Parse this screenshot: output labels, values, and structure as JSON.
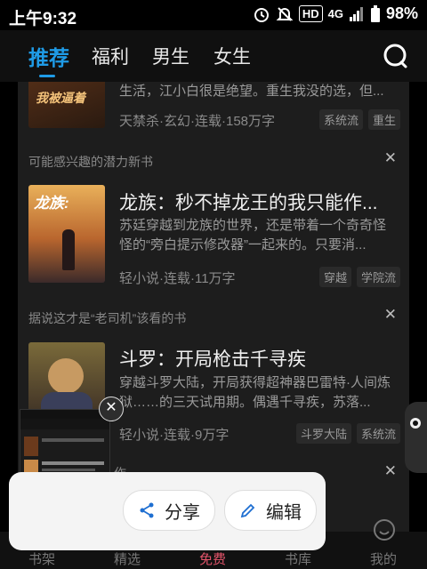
{
  "status": {
    "time": "上午9:32",
    "hd": "HD",
    "network": "4G",
    "battery": "98%"
  },
  "tabs": [
    "推荐",
    "福利",
    "男生",
    "女生"
  ],
  "books": [
    {
      "title": "",
      "desc_tail": "生活，江小白很是绝望。重生我没的选，但...",
      "meta": "天禁杀·玄幻·连载·158万字",
      "tags": [
        "系统流",
        "重生"
      ]
    },
    {
      "section": "可能感兴趣的潜力新书",
      "title": "龙族：秒不掉龙王的我只能作...",
      "desc": "苏廷穿越到龙族的世界，还是带着一个奇奇怪怪的“旁白提示修改器”一起来的。只要消...",
      "meta": "轻小说·连载·11万字",
      "tags": [
        "穿越",
        "学院流"
      ],
      "cover_text": "龙族:"
    },
    {
      "section": "据说这才是“老司机”该看的书",
      "title": "斗罗：开局枪击千寻疾",
      "desc": "穿越斗罗大陆，开局获得超神器巴雷特·人间炼狱……的三天试用期。偶遇千寻疾，苏落...",
      "meta": "轻小说·连载·9万字",
      "tags": [
        "斗罗大陆",
        "系统流"
      ]
    }
  ],
  "next_section_partial": "作",
  "sheet": {
    "share": "分享",
    "edit": "编辑"
  },
  "bottomnav": [
    "书架",
    "精选",
    "免费",
    "书库",
    "我的"
  ],
  "colors": {
    "accent": "#1f9be6",
    "nav_active": "#e2546a"
  }
}
